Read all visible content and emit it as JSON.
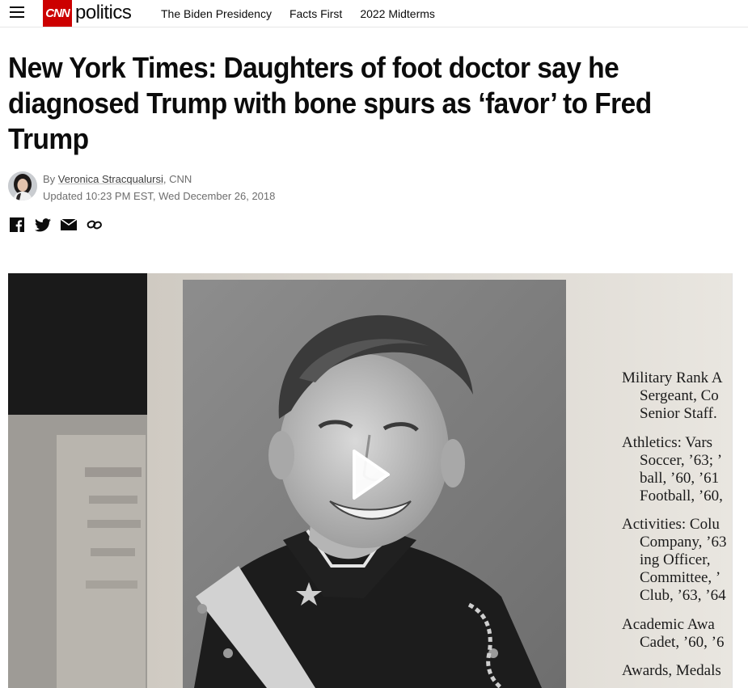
{
  "header": {
    "logo": "CNN",
    "section": "politics",
    "nav": [
      {
        "label": "The Biden Presidency"
      },
      {
        "label": "Facts First"
      },
      {
        "label": "2022 Midterms"
      }
    ]
  },
  "article": {
    "headline": "New York Times: Daughters of foot doctor say he diagnosed Trump with bone spurs as ‘favor’ to Fred Trump",
    "byline_prefix": "By ",
    "author": "Veronica Stracqualursi",
    "outlet": ", CNN",
    "updated": "Updated 10:23 PM EST, Wed December 26, 2018"
  },
  "share": [
    "facebook-icon",
    "twitter-icon",
    "email-icon",
    "link-icon"
  ],
  "video": {
    "yearbook_lines": [
      {
        "text": "Military Rank A",
        "indent": false
      },
      {
        "text": "Sergeant, Co",
        "indent": true
      },
      {
        "text": "Senior Staff.",
        "indent": true
      },
      {
        "text": "Athletics: Vars",
        "indent": false
      },
      {
        "text": "Soccer, ’63; ’",
        "indent": true
      },
      {
        "text": "ball, ’60, ’61",
        "indent": true
      },
      {
        "text": "Football, ’60,",
        "indent": true
      },
      {
        "text": "Activities: Colu",
        "indent": false
      },
      {
        "text": "Company, ’63",
        "indent": true
      },
      {
        "text": "ing Officer,",
        "indent": true
      },
      {
        "text": "Committee, ’",
        "indent": true
      },
      {
        "text": "Club, ’63, ’64",
        "indent": true
      },
      {
        "text": "Academic Awa",
        "indent": false
      },
      {
        "text": "Cadet, ’60, ’6",
        "indent": true
      },
      {
        "text": "Awards, Medals",
        "indent": false
      }
    ]
  }
}
